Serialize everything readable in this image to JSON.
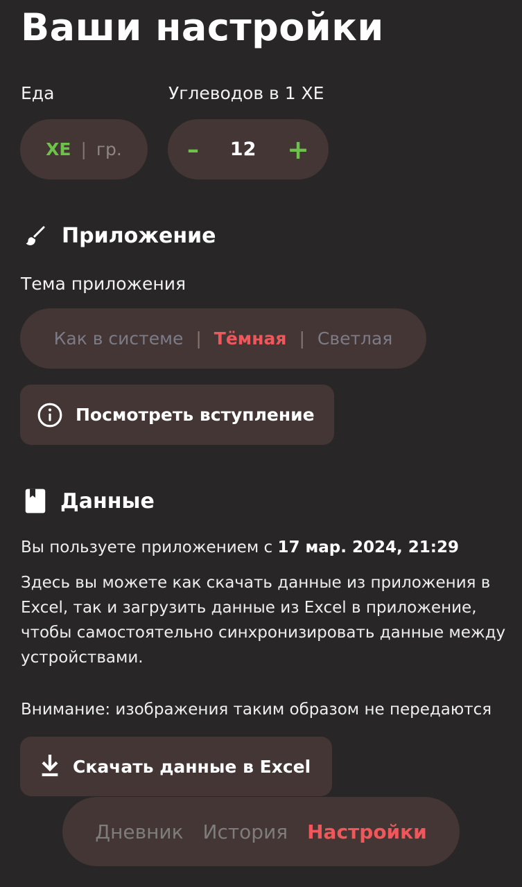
{
  "page_title": "Ваши настройки",
  "food": {
    "label": "Еда",
    "options": [
      "ХЕ",
      "гр."
    ],
    "separator": "|",
    "selected": "ХЕ"
  },
  "carbs": {
    "label": "Углеводов в 1 ХЕ",
    "minus": "–",
    "value": "12",
    "plus": "+"
  },
  "app_section": {
    "icon": "brush-icon",
    "title": "Приложение",
    "theme_label": "Тема приложения",
    "theme_options": [
      "Как в системе",
      "Тёмная",
      "Светлая"
    ],
    "separator": "|",
    "selected_theme": "Тёмная",
    "intro_button": {
      "icon": "info-icon",
      "label": "Посмотреть вступление"
    }
  },
  "data_section": {
    "icon": "book-icon",
    "title": "Данные",
    "since_prefix": "Вы пользуете приложением с",
    "since_date": "17 мар. 2024, 21:29",
    "description": "Здесь вы можете как скачать данные из приложения в Excel, так и загрузить данные из Excel в приложение, чтобы самостоятельно синхронизировать данные между устройствами.",
    "warning": "Внимание: изображения таким образом не передаются",
    "download_button": {
      "icon": "download-icon",
      "label": "Скачать данные в Excel"
    }
  },
  "tabbar": {
    "tabs": [
      "Дневник",
      "История",
      "Настройки"
    ],
    "active": "Настройки"
  },
  "colors": {
    "background": "#282626",
    "surface": "#433635",
    "accent_green": "#6cc24a",
    "accent_red": "#f0575b"
  }
}
